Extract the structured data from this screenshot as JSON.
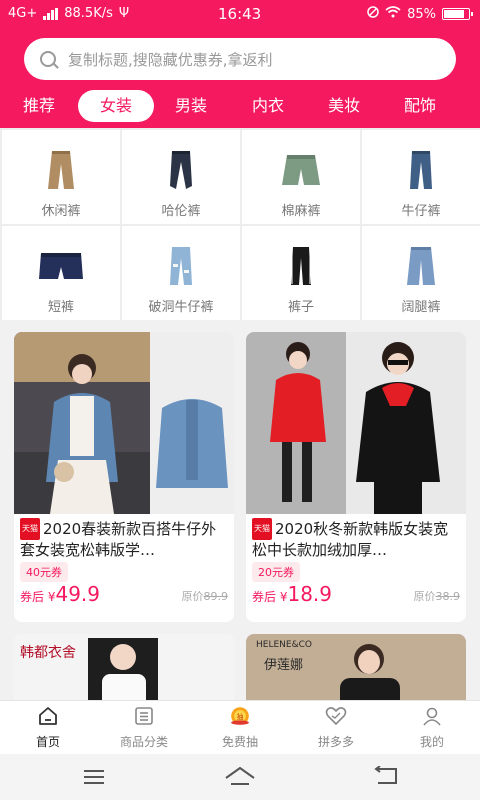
{
  "status": {
    "network": "4G+",
    "speed": "88.5K/s",
    "time": "16:43",
    "battery": "85%"
  },
  "search": {
    "placeholder": "复制标题,搜隐藏优惠券,拿返利"
  },
  "tabs": [
    {
      "label": "推荐",
      "active": false
    },
    {
      "label": "女装",
      "active": true
    },
    {
      "label": "男装",
      "active": false
    },
    {
      "label": "内衣",
      "active": false
    },
    {
      "label": "美妆",
      "active": false
    },
    {
      "label": "配饰",
      "active": false
    }
  ],
  "categories": [
    {
      "label": "休闲裤",
      "icon": "casual-pants-icon"
    },
    {
      "label": "哈伦裤",
      "icon": "harem-pants-icon"
    },
    {
      "label": "棉麻裤",
      "icon": "linen-pants-icon"
    },
    {
      "label": "牛仔裤",
      "icon": "jeans-icon"
    },
    {
      "label": "短裤",
      "icon": "shorts-icon"
    },
    {
      "label": "破洞牛仔裤",
      "icon": "ripped-jeans-icon"
    },
    {
      "label": "裤子",
      "icon": "trousers-icon"
    },
    {
      "label": "阔腿裤",
      "icon": "wide-leg-pants-icon"
    }
  ],
  "products": [
    {
      "platform": "天猫",
      "title": "2020春装新款百搭牛仔外套女装宽松韩版学…",
      "coupon": "40元券",
      "after_label": "券后",
      "currency": "¥",
      "price": "49.9",
      "orig_label": "原价",
      "orig_price": "89.9"
    },
    {
      "platform": "天猫",
      "title": "2020秋冬新款韩版女装宽松中长款加绒加厚…",
      "coupon": "20元券",
      "after_label": "券后",
      "currency": "¥",
      "price": "18.9",
      "orig_label": "原价",
      "orig_price": "38.9"
    }
  ],
  "partial_cards": [
    {
      "brand": "韩都衣舍"
    },
    {
      "brand_en": "HELENE&CO",
      "brand": "伊莲娜"
    }
  ],
  "nav": [
    {
      "label": "首页",
      "icon": "home-icon",
      "active": true
    },
    {
      "label": "商品分类",
      "icon": "category-list-icon",
      "active": false
    },
    {
      "label": "免费抽",
      "icon": "lottery-coin-icon",
      "active": false
    },
    {
      "label": "拼多多",
      "icon": "pinduoduo-heart-icon",
      "active": false
    },
    {
      "label": "我的",
      "icon": "user-icon",
      "active": false
    }
  ],
  "colors": {
    "accent": "#f5195f",
    "tmall": "#e30f23"
  }
}
